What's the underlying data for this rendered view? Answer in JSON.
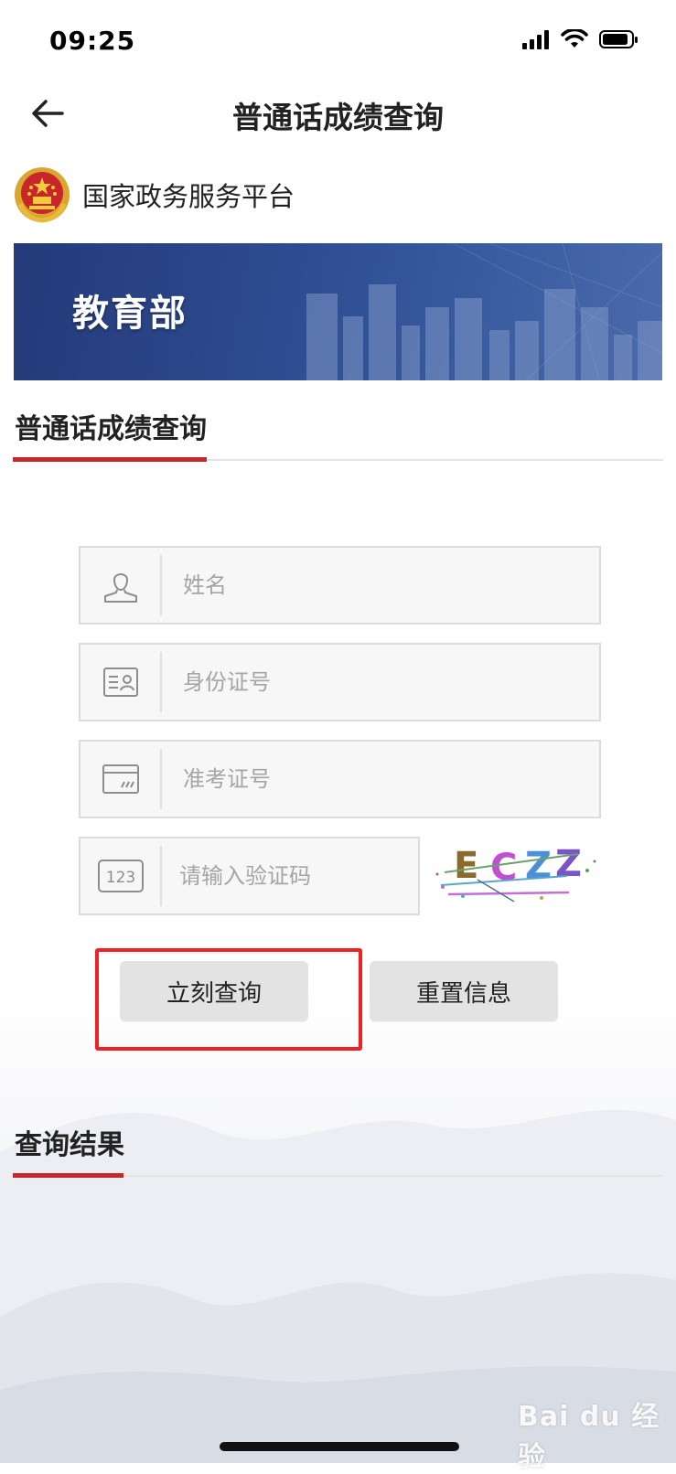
{
  "status_bar": {
    "time": "09:25"
  },
  "nav": {
    "title": "普通话成绩查询"
  },
  "platform": {
    "name": "国家政务服务平台"
  },
  "banner": {
    "title": "教育部"
  },
  "query_section": {
    "title": "普通话成绩查询"
  },
  "form": {
    "name_placeholder": "姓名",
    "id_placeholder": "身份证号",
    "exam_placeholder": "准考证号",
    "captcha_placeholder": "请输入验证码",
    "captcha_text": "ECZZ"
  },
  "buttons": {
    "query": "立刻查询",
    "reset": "重置信息"
  },
  "result_section": {
    "title": "查询结果"
  },
  "colors": {
    "accent_red": "#c4282b",
    "highlight_red": "#ee2222",
    "banner_blue": "#2e4d92"
  },
  "watermark": "Bai du 经验"
}
